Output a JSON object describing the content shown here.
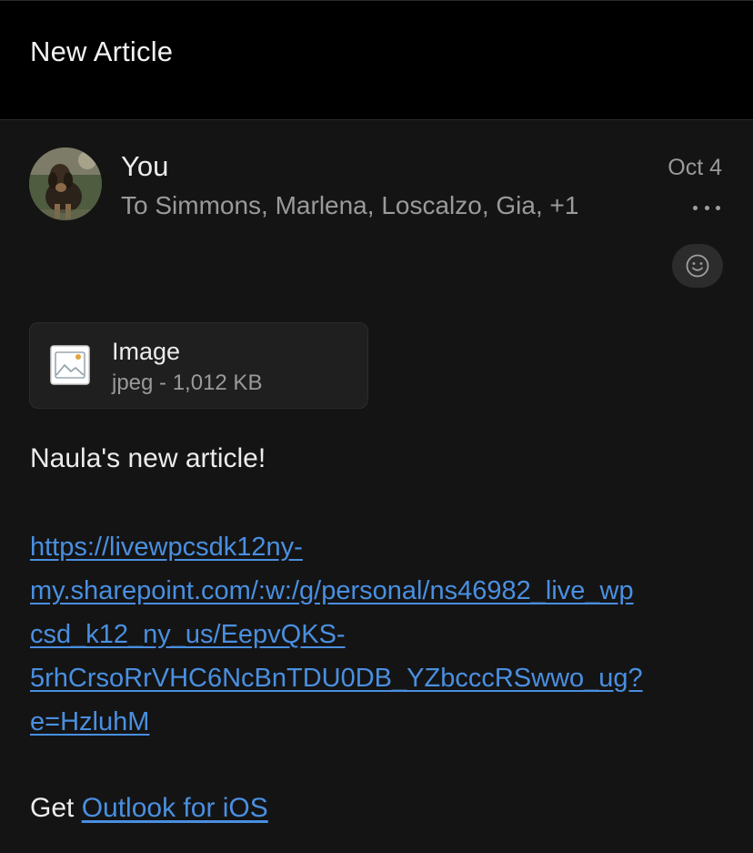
{
  "header": {
    "title": "New Article"
  },
  "message": {
    "sender": "You",
    "recipients": "To Simmons, Marlena, Loscalzo, Gia, +1",
    "date": "Oct 4",
    "more_icon": "ellipsis-icon",
    "reaction_icon": "smiley-icon",
    "attachment": {
      "name": "Image",
      "meta": "jpeg - 1,012 KB",
      "icon": "image-file-icon"
    },
    "body": "Naula's new article!",
    "link_lines": [
      "https://livewpcsdk12ny-",
      "my.sharepoint.com/:w:/g/personal/ns46982_live_wp",
      "csd_k12_ny_us/EepvQKS-",
      "5rhCrsoRrVHC6NcBnTDU0DB_YZbcccRSwwo_ug?",
      "e=HzluhM"
    ],
    "signature_prefix": "Get ",
    "signature_link": "Outlook for iOS"
  },
  "colors": {
    "background": "#141414",
    "header": "#000000",
    "link": "#4a8fe0",
    "secondary_text": "#9a9a9a"
  }
}
